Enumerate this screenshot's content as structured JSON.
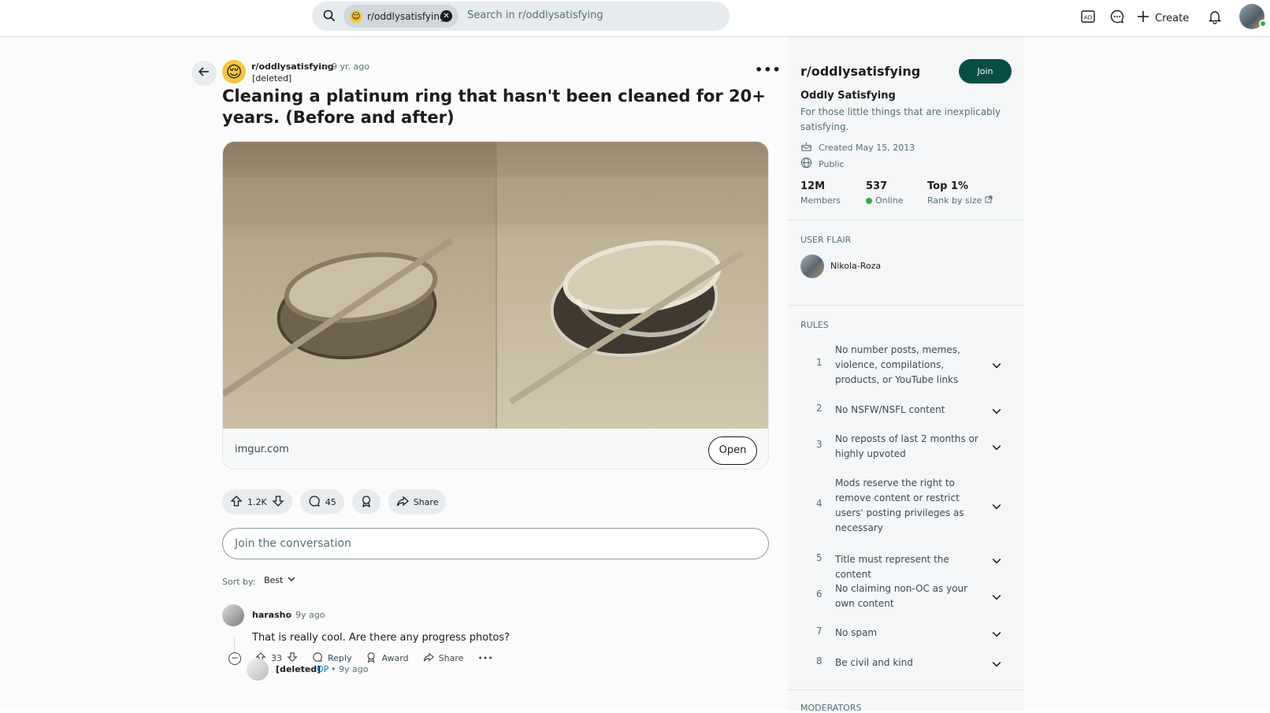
{
  "topbar": {
    "search_chip": "r/oddlysatisfying",
    "search_placeholder": "Search in r/oddlysatisfying",
    "create_label": "Create",
    "icons": [
      "search-icon",
      "close-icon",
      "ad-icon",
      "chat-icon",
      "plus-icon",
      "bell-icon"
    ]
  },
  "post": {
    "subreddit": "r/oddlysatisfying",
    "age": "• 9 yr. ago",
    "author": "[deleted]",
    "title": "Cleaning a platinum ring that hasn't been cleaned for 20+ years. (Before and after)",
    "media_domain": "imgur.com",
    "open_label": "Open",
    "votes": "1.2K",
    "comments": "45",
    "share_label": "Share"
  },
  "comment_box": {
    "placeholder": "Join the conversation"
  },
  "sort": {
    "label": "Sort by:",
    "value": "Best"
  },
  "comments": [
    {
      "author": "harasho",
      "meta": "• 9y ago",
      "body": "That is really cool. Are there any progress photos?",
      "votes": "33",
      "reply_label": "Reply",
      "award_label": "Award",
      "share_label": "Share"
    },
    {
      "author": "[deleted]",
      "op_tag": "OP",
      "meta": "• 9y ago"
    }
  ],
  "sidebar": {
    "title": "r/oddlysatisfying",
    "join_label": "Join",
    "name": "Oddly Satisfying",
    "description": "For those little things that are inexplicably satisfying.",
    "created": "Created May 15, 2013",
    "visibility": "Public",
    "stats": [
      {
        "value": "12M",
        "label": "Members"
      },
      {
        "value": "537",
        "label": "Online"
      },
      {
        "value": "Top 1%",
        "label": "Rank by size"
      }
    ],
    "user_flair_heading": "USER FLAIR",
    "flair_user": "Nikola-Roza",
    "rules_heading": "RULES",
    "rules": [
      {
        "num": "1",
        "text": "No number posts, memes, violence, compilations, products, or YouTube links"
      },
      {
        "num": "2",
        "text": "No NSFW/NSFL content"
      },
      {
        "num": "3",
        "text": "No reposts of last 2 months or highly upvoted"
      },
      {
        "num": "4",
        "text": "Mods reserve the right to remove content or restrict users' posting privileges as necessary"
      },
      {
        "num": "5",
        "text": "Title must represent the content"
      },
      {
        "num": "6",
        "text": "No claiming non-OC as your own content"
      },
      {
        "num": "7",
        "text": "No spam"
      },
      {
        "num": "8",
        "text": "Be civil and kind"
      }
    ],
    "moderators_heading": "MODERATORS"
  },
  "colors": {
    "join": "#0a4d45",
    "online": "#2fb344",
    "op": "#0079d3"
  }
}
